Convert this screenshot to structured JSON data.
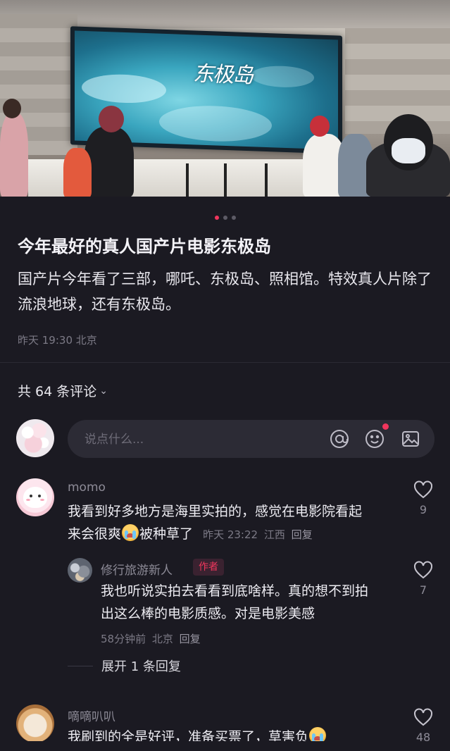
{
  "colors": {
    "background": "#1b1a22",
    "accent": "#f0365d",
    "muted": "#7c7a86"
  },
  "hero": {
    "screen_text": "东极岛",
    "carousel": {
      "count": 3,
      "active_index": 0
    }
  },
  "post": {
    "title": "今年最好的真人国产片电影东极岛",
    "body": "国产片今年看了三部，哪吒、东极岛、照相馆。特效真人片除了流浪地球，还有东极岛。",
    "meta": "昨天 19:30 北京"
  },
  "comments_header": {
    "count_label": "共 64 条评论",
    "chevron_icon": "chevron-down-icon"
  },
  "input": {
    "placeholder": "说点什么...",
    "icons": [
      "at-icon",
      "emoji-icon",
      "image-icon"
    ]
  },
  "comments": [
    {
      "user": "momo",
      "text_part1": "我看到好多地方是海里实拍的，感觉在电影院看起",
      "text_part2": "来会很爽",
      "text_part3": "被种草了",
      "time": "昨天 23:22",
      "location": "江西",
      "reply_label": "回复",
      "likes": "9"
    },
    {
      "user": "修行旅游新人",
      "badge": "作者",
      "text_line1": "我也听说实拍去看看到底啥样。真的想不到拍",
      "text_line2": "出这么棒的电影质感。对是电影美感",
      "time": "58分钟前",
      "location": "北京",
      "reply_label": "回复",
      "likes": "7"
    },
    {
      "user": "嘀嘀叭叭",
      "text_part1": "我刷到的全是好评，准备买票了，草害负",
      "likes": "48"
    }
  ],
  "expand_replies": "展开 1 条回复"
}
